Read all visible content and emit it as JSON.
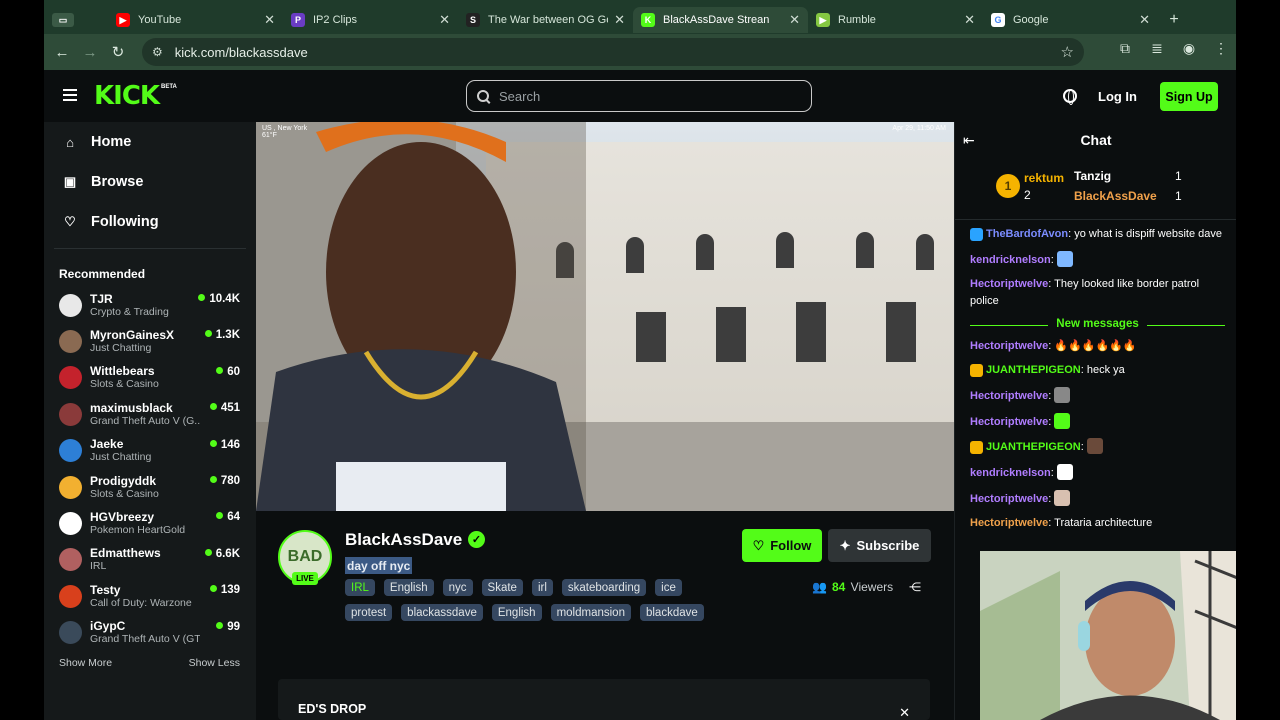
{
  "browser": {
    "tabs": [
      {
        "title": "YouTube",
        "fav_color": "#ff0000",
        "fav_glyph": "▶"
      },
      {
        "title": "IP2 Clips",
        "fav_color": "#6a3cc4",
        "fav_glyph": "P"
      },
      {
        "title": "The War between OG Ge",
        "fav_color": "#222222",
        "fav_glyph": "S"
      },
      {
        "title": "BlackAssDave Strean",
        "fav_color": "#53fc18",
        "fav_glyph": "K"
      },
      {
        "title": "Rumble",
        "fav_color": "#85c742",
        "fav_glyph": "▶"
      },
      {
        "title": "Google",
        "fav_color": "#ffffff",
        "fav_glyph": "G"
      }
    ],
    "url": "kick.com/blackassdave"
  },
  "header": {
    "logo": "KICK",
    "beta": "BETA",
    "search_placeholder": "Search",
    "login": "Log In",
    "signup": "Sign Up"
  },
  "sidebar": {
    "nav": [
      {
        "label": "Home",
        "icon": "home-icon",
        "glyph": "⌂"
      },
      {
        "label": "Browse",
        "icon": "browse-icon",
        "glyph": "▣"
      },
      {
        "label": "Following",
        "icon": "heart-icon",
        "glyph": "♡"
      }
    ],
    "recommended_title": "Recommended",
    "recommended": [
      {
        "name": "TJR",
        "category": "Crypto & Trading",
        "viewers": "10.4K",
        "avatar": "#e8e8e8"
      },
      {
        "name": "MyronGainesX",
        "category": "Just Chatting",
        "viewers": "1.3K",
        "avatar": "#8a6a52"
      },
      {
        "name": "Wittlebears",
        "category": "Slots & Casino",
        "viewers": "60",
        "avatar": "#c4222c"
      },
      {
        "name": "maximusblack",
        "category": "Grand Theft Auto V (G...",
        "viewers": "451",
        "avatar": "#8a3a3a"
      },
      {
        "name": "Jaeke",
        "category": "Just Chatting",
        "viewers": "146",
        "avatar": "#2d7fd6"
      },
      {
        "name": "Prodigyddk",
        "category": "Slots & Casino",
        "viewers": "780",
        "avatar": "#f2b030"
      },
      {
        "name": "HGVbreezy",
        "category": "Pokemon HeartGold",
        "viewers": "64",
        "avatar": "#ffffff"
      },
      {
        "name": "Edmatthews",
        "category": "IRL",
        "viewers": "6.6K",
        "avatar": "#b06060"
      },
      {
        "name": "Testy",
        "category": "Call of Duty: Warzone",
        "viewers": "139",
        "avatar": "#d8401c"
      },
      {
        "name": "iGypC",
        "category": "Grand Theft Auto V (GTA)",
        "viewers": "99",
        "avatar": "#3a4a5a"
      }
    ],
    "show_more": "Show More",
    "show_less": "Show Less"
  },
  "video": {
    "location": "US , New York",
    "temp": "61°F",
    "date": "Apr 29, 11:50 AM"
  },
  "channel": {
    "avatar_text": "BAD",
    "live": "LIVE",
    "name": "BlackAssDave",
    "title": "day off nyc",
    "tags": [
      "IRL",
      "English",
      "nyc",
      "Skate",
      "irl",
      "skateboarding",
      "ice",
      "protest",
      "blackassdave",
      "English",
      "moldmansion",
      "blackdave"
    ],
    "follow": "Follow",
    "subscribe": "Subscribe",
    "viewers_count": "84",
    "viewers_label": "Viewers",
    "drop_title": "ED'S DROP"
  },
  "chat": {
    "title": "Chat",
    "leaderboard": {
      "rank": "1",
      "top_user": "rektum",
      "top_count": "2",
      "rows": [
        {
          "user": "Tanzig",
          "count": "1"
        },
        {
          "user": "BlackAssDave",
          "count": "1"
        }
      ]
    },
    "messages_before": [
      {
        "user": "TheBardofAvon",
        "color": "#7b8cff",
        "text": "yo what is dispiff website dave",
        "badge": "#2aa3ff"
      },
      {
        "user": "kendricknelson",
        "color": "#b07dff",
        "text": "",
        "emote": "#7fb8ff"
      },
      {
        "user": "Hectoriptwelve",
        "color": "#b07dff",
        "text": "They looked like border patrol police"
      }
    ],
    "new_messages_label": "New messages",
    "messages_after": [
      {
        "user": "Hectoriptwelve",
        "color": "#b07dff",
        "text": "🔥🔥🔥🔥🔥🔥"
      },
      {
        "user": "JUANTHEPIGEON",
        "color": "#53fc18",
        "text": "heck ya",
        "badge": "#f5b300"
      },
      {
        "user": "Hectoriptwelve",
        "color": "#b07dff",
        "text": "",
        "emote": "#888888"
      },
      {
        "user": "Hectoriptwelve",
        "color": "#b07dff",
        "text": "",
        "emote": "#53fc18"
      },
      {
        "user": "JUANTHEPIGEON",
        "color": "#53fc18",
        "text": "",
        "badge": "#f5b300",
        "emote": "#6a4a3a"
      },
      {
        "user": "kendricknelson",
        "color": "#b07dff",
        "text": "",
        "emote": "#ffffff"
      },
      {
        "user": "Hectoriptwelve",
        "color": "#b07dff",
        "text": "",
        "emote": "#d8c0b0"
      },
      {
        "user": "Hectoriptwelve",
        "color": "#f0a14b",
        "text": "Trataria architecture"
      }
    ]
  },
  "colors": {
    "accent": "#53fc18",
    "bg": "#0b0e0f",
    "sidebar": "#15191a"
  }
}
